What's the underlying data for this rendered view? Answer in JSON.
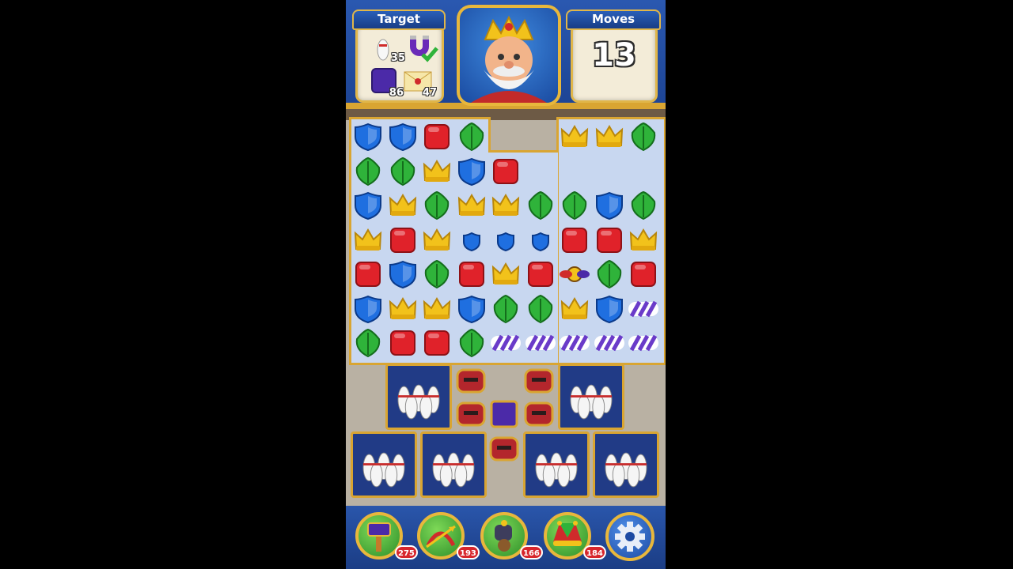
{
  "header": {
    "target_label": "Target",
    "moves_label": "Moves",
    "moves_value": "13",
    "targets": [
      {
        "icon": "bowling-pin-icon",
        "count": "35"
      },
      {
        "icon": "magnet-icon",
        "count": "",
        "completed": true
      },
      {
        "icon": "purple-block-icon",
        "count": "86"
      },
      {
        "icon": "letter-icon",
        "count": "47"
      }
    ]
  },
  "character": {
    "icon": "king-portrait"
  },
  "board": {
    "rows": [
      [
        "shield",
        "shield",
        "cube",
        "leaf",
        null,
        null,
        "crown",
        "crown",
        "leaf"
      ],
      [
        "leaf",
        "leaf",
        "crown",
        "shield",
        "cube",
        null,
        null,
        null,
        null
      ],
      [
        "shield",
        "crown",
        "leaf",
        "crown",
        "crown",
        "leaf",
        "leaf",
        "shield",
        "leaf"
      ],
      [
        "crown",
        "cube",
        "crown",
        "small-shield",
        "small-shield",
        "small-shield",
        "cube",
        "cube",
        "crown"
      ],
      [
        "cube",
        "shield",
        "leaf",
        "cube",
        "crown",
        "cube",
        "propeller",
        "leaf",
        "cube"
      ],
      [
        "shield",
        "crown",
        "crown",
        "shield",
        "leaf",
        "leaf",
        "crown",
        "shield",
        "striped"
      ],
      [
        "leaf",
        "cube",
        "cube",
        "leaf",
        "striped",
        "striped",
        "striped",
        "striped",
        "striped"
      ]
    ],
    "colors": {
      "shield": "#1f6fe0",
      "cube": "#e0222a",
      "leaf": "#2fb33a",
      "crown": "#f2c21b",
      "board": "#c8d7f0",
      "frame": "#d9a532"
    }
  },
  "bottom_bar": {
    "boosters": [
      {
        "icon": "hammer-icon",
        "count": "275"
      },
      {
        "icon": "arrow-icon",
        "count": "193"
      },
      {
        "icon": "cannon-icon",
        "count": "166"
      },
      {
        "icon": "jester-hat-icon",
        "count": "184"
      }
    ],
    "settings_icon": "gear-icon"
  }
}
